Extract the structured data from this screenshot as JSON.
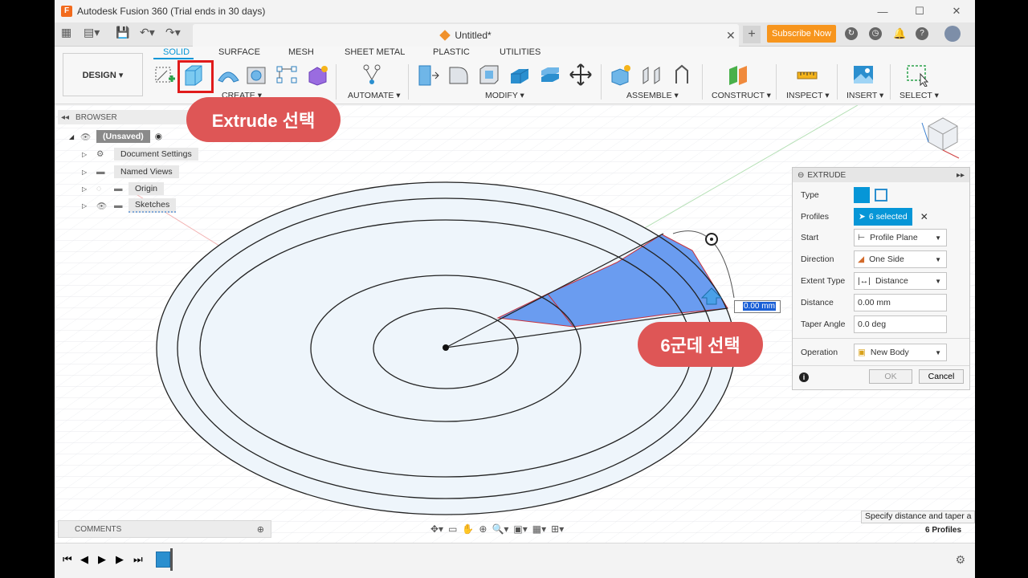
{
  "window": {
    "title": "Autodesk Fusion 360 (Trial ends in 30 days)",
    "logo_letter": "F"
  },
  "tabbar": {
    "doc_title": "Untitled*",
    "subscribe_label": "Subscribe Now"
  },
  "toolbar": {
    "design_label": "DESIGN ▾",
    "workspace_tabs": [
      "SOLID",
      "SURFACE",
      "MESH",
      "SHEET METAL",
      "PLASTIC",
      "UTILITIES"
    ],
    "groups": [
      "CREATE ▾",
      "AUTOMATE ▾",
      "MODIFY ▾",
      "ASSEMBLE ▾",
      "CONSTRUCT ▾",
      "INSPECT ▾",
      "INSERT ▾",
      "SELECT ▾"
    ]
  },
  "browser": {
    "header": "BROWSER",
    "items": [
      {
        "label": "(Unsaved)",
        "icon": "component-icon"
      },
      {
        "label": "Document Settings",
        "icon": "gear-icon"
      },
      {
        "label": "Named Views",
        "icon": "folder-icon"
      },
      {
        "label": "Origin",
        "icon": "folder-icon"
      },
      {
        "label": "Sketches",
        "icon": "folder-icon"
      }
    ]
  },
  "comments": {
    "label": "COMMENTS"
  },
  "annotations": {
    "extrude_callout": "Extrude 선택",
    "profiles_callout": "6군데 선택"
  },
  "dimension_input": {
    "value": "0.00 mm"
  },
  "extrude_panel": {
    "title": "EXTRUDE",
    "rows": [
      {
        "label": "Type"
      },
      {
        "label": "Profiles",
        "value": "6 selected"
      },
      {
        "label": "Start",
        "value": "Profile Plane"
      },
      {
        "label": "Direction",
        "value": "One Side"
      },
      {
        "label": "Extent Type",
        "value": "Distance"
      },
      {
        "label": "Distance",
        "value": "0.00 mm"
      },
      {
        "label": "Taper Angle",
        "value": "0.0 deg"
      },
      {
        "label": "Operation",
        "value": "New Body"
      }
    ],
    "ok_label": "OK",
    "cancel_label": "Cancel"
  },
  "status": {
    "hint": "Specify distance and taper a",
    "profiles_count": "6 Profiles"
  },
  "colors": {
    "accent": "#0696d7",
    "callout": "#de5656",
    "highlight_box": "#e01b1b",
    "selection_fill": "#6a9cf0",
    "subscribe": "#f7951d"
  }
}
